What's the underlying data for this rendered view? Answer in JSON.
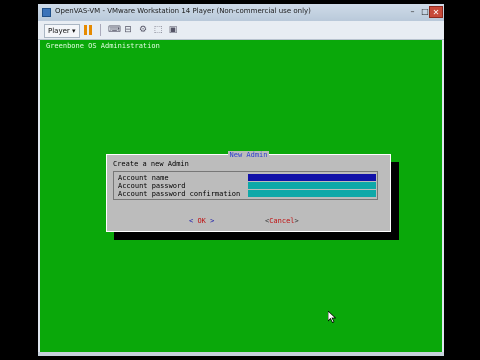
{
  "window": {
    "title": "OpenVAS-VM - VMware Workstation 14 Player (Non-commercial use only)",
    "minimize": "–",
    "maximize": "□",
    "close": "✕"
  },
  "toolbar": {
    "player_label": "Player ▾",
    "icons": [
      "pause-icon",
      "send-ctrl-alt-del-icon",
      "removable-devices-icon",
      "settings-icon",
      "fullscreen-icon",
      "unity-icon"
    ]
  },
  "vm_screen": {
    "header": "Greenbone OS Administration",
    "background_color": "#0aa80a"
  },
  "dialog": {
    "title": "New Admin",
    "prompt": "Create a new Admin",
    "fields": [
      {
        "label": "Account name",
        "value": ""
      },
      {
        "label": "Account password",
        "value": ""
      },
      {
        "label": "Account password confirmation",
        "value": ""
      }
    ],
    "ok_prefix": "<",
    "ok_label": "OK",
    "ok_suffix": ">",
    "cancel_prefix": "<",
    "cancel_label": "Cancel",
    "cancel_suffix": ">"
  }
}
